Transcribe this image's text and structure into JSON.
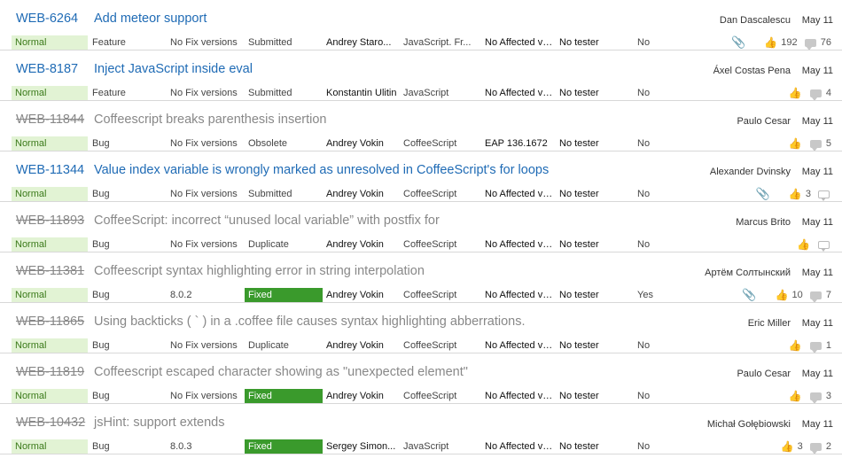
{
  "issues": [
    {
      "id": "WEB-6264",
      "summary": "Add meteor support",
      "reporter": "Dan Dascalescu",
      "date": "May 11",
      "priority": "Normal",
      "type": "Feature",
      "fix_versions": "No Fix versions",
      "state": "Submitted",
      "state_fixed": false,
      "assignee": "Andrey Staro...",
      "subsystem": "JavaScript. Fr...",
      "affected": "No Affected vers",
      "tester": "No tester",
      "yesno": "No",
      "attachment": true,
      "votes": "192",
      "comments": "76",
      "resolved": false
    },
    {
      "id": "WEB-8187",
      "summary": "Inject JavaScript inside eval",
      "reporter": "Áxel Costas Pena",
      "date": "May 11",
      "priority": "Normal",
      "type": "Feature",
      "fix_versions": "No Fix versions",
      "state": "Submitted",
      "state_fixed": false,
      "assignee": "Konstantin Ulitin",
      "subsystem": "JavaScript",
      "affected": "No Affected vers",
      "tester": "No tester",
      "yesno": "No",
      "attachment": false,
      "votes": "",
      "comments": "4",
      "resolved": false
    },
    {
      "id": "WEB-11844",
      "summary": "Coffeescript breaks parenthesis insertion",
      "reporter": "Paulo Cesar",
      "date": "May 11",
      "priority": "Normal",
      "type": "Bug",
      "fix_versions": "No Fix versions",
      "state": "Obsolete",
      "state_fixed": false,
      "assignee": "Andrey Vokin",
      "subsystem": "CoffeeScript",
      "affected": "EAP 136.1672",
      "tester": "No tester",
      "yesno": "No",
      "attachment": false,
      "votes": "",
      "comments": "5",
      "resolved": true
    },
    {
      "id": "WEB-11344",
      "summary": "Value index variable is wrongly marked as unresolved in CoffeeScript's for loops",
      "reporter": "Alexander Dvinsky",
      "date": "May 11",
      "priority": "Normal",
      "type": "Bug",
      "fix_versions": "No Fix versions",
      "state": "Submitted",
      "state_fixed": false,
      "assignee": "Andrey Vokin",
      "subsystem": "CoffeeScript",
      "affected": "No Affected vers",
      "tester": "No tester",
      "yesno": "No",
      "attachment": true,
      "votes": "3",
      "comments": "",
      "resolved": false
    },
    {
      "id": "WEB-11893",
      "summary": "CoffeeScript: incorrect “unused local variable” with postfix for",
      "reporter": "Marcus Brito",
      "date": "May 11",
      "priority": "Normal",
      "type": "Bug",
      "fix_versions": "No Fix versions",
      "state": "Duplicate",
      "state_fixed": false,
      "assignee": "Andrey Vokin",
      "subsystem": "CoffeeScript",
      "affected": "No Affected vers",
      "tester": "No tester",
      "yesno": "No",
      "attachment": false,
      "votes": "",
      "comments": "",
      "resolved": true
    },
    {
      "id": "WEB-11381",
      "summary": "Coffeescript syntax highlighting error in string interpolation",
      "reporter": "Артём Солтынский",
      "date": "May 11",
      "priority": "Normal",
      "type": "Bug",
      "fix_versions": "8.0.2",
      "state": "Fixed",
      "state_fixed": true,
      "assignee": "Andrey Vokin",
      "subsystem": "CoffeeScript",
      "affected": "No Affected vers",
      "tester": "No tester",
      "yesno": "Yes",
      "attachment": true,
      "votes": "10",
      "comments": "7",
      "resolved": true
    },
    {
      "id": "WEB-11865",
      "summary": "Using backticks ( ` ) in a .coffee file causes syntax highlighting abberrations.",
      "reporter": "Eric Miller",
      "date": "May 11",
      "priority": "Normal",
      "type": "Bug",
      "fix_versions": "No Fix versions",
      "state": "Duplicate",
      "state_fixed": false,
      "assignee": "Andrey Vokin",
      "subsystem": "CoffeeScript",
      "affected": "No Affected vers",
      "tester": "No tester",
      "yesno": "No",
      "attachment": false,
      "votes": "",
      "comments": "1",
      "resolved": true
    },
    {
      "id": "WEB-11819",
      "summary": "Coffeescript escaped character showing as \"unexpected element\"",
      "reporter": "Paulo Cesar",
      "date": "May 11",
      "priority": "Normal",
      "type": "Bug",
      "fix_versions": "No Fix versions",
      "state": "Fixed",
      "state_fixed": true,
      "assignee": "Andrey Vokin",
      "subsystem": "CoffeeScript",
      "affected": "No Affected vers",
      "tester": "No tester",
      "yesno": "No",
      "attachment": false,
      "votes": "",
      "comments": "3",
      "resolved": true
    },
    {
      "id": "WEB-10432",
      "summary": "jsHint: support extends",
      "reporter": "Michał Gołębiowski",
      "date": "May 11",
      "priority": "Normal",
      "type": "Bug",
      "fix_versions": "8.0.3",
      "state": "Fixed",
      "state_fixed": true,
      "assignee": "Sergey Simon...",
      "subsystem": "JavaScript",
      "affected": "No Affected vers",
      "tester": "No tester",
      "yesno": "No",
      "attachment": false,
      "votes": "3",
      "comments": "2",
      "resolved": true
    }
  ],
  "icons": {
    "attachment": "paperclip-icon",
    "vote": "thumbs-up-icon",
    "comment": "comment-bubble-icon"
  }
}
